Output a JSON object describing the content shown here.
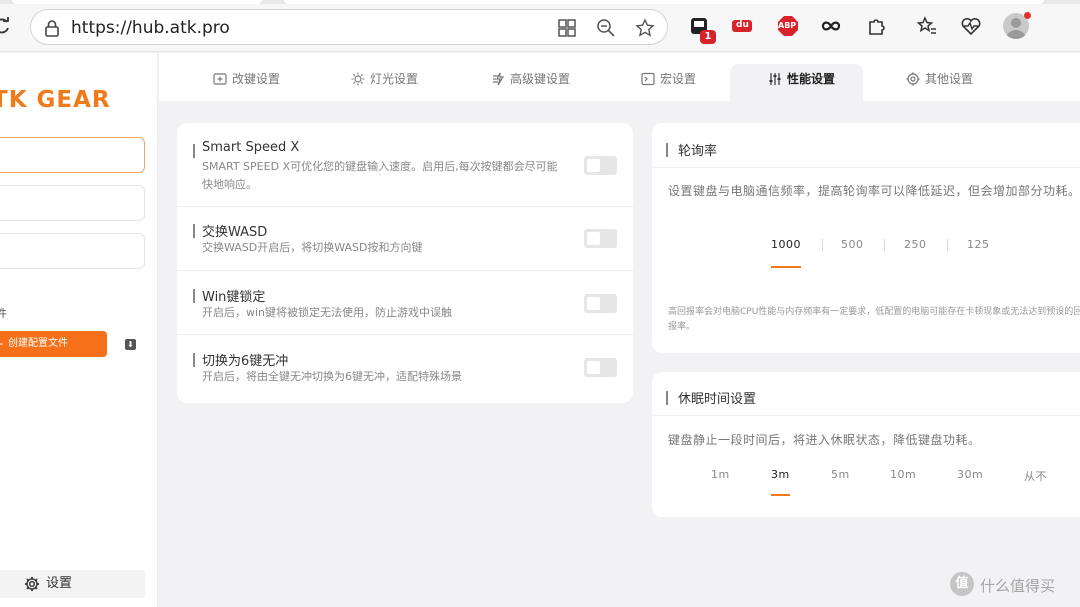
{
  "browser": {
    "url": "https://hub.atk.pro",
    "extension_badge_count": "1",
    "extension_du": "du",
    "extension_abp": "ABP"
  },
  "sidebar": {
    "logo": "TK GEAR",
    "section_label": "件",
    "create_button": "创建配置文件",
    "settings_button": "设置"
  },
  "tabs": [
    {
      "label": "改键设置",
      "icon": "keyboard-add-icon"
    },
    {
      "label": "灯光设置",
      "icon": "sun-icon"
    },
    {
      "label": "高级键设置",
      "icon": "bolt-icon"
    },
    {
      "label": "宏设置",
      "icon": "terminal-icon"
    },
    {
      "label": "性能设置",
      "icon": "sliders-icon"
    },
    {
      "label": "其他设置",
      "icon": "gear-icon"
    }
  ],
  "active_tab": "性能设置",
  "features": [
    {
      "title": "Smart Speed X",
      "desc": "SMART SPEED X可优化您的键盘输入速度。启用后,每次按键都会尽可能快地响应。",
      "enabled": false
    },
    {
      "title": "交换WASD",
      "desc": "交换WASD开启后，将切换WASD按和方向键",
      "enabled": false
    },
    {
      "title": "Win键锁定",
      "desc": "开启后，win键将被锁定无法使用，防止游戏中误触",
      "enabled": false
    },
    {
      "title": "切换为6键无冲",
      "desc": "开启后，将由全键无冲切换为6键无冲，适配特殊场景",
      "enabled": false
    }
  ],
  "polling": {
    "title": "轮询率",
    "desc": "设置键盘与电脑通信频率，提高轮询率可以降低延迟，但会增加部分功耗。",
    "options": [
      "1000",
      "500",
      "250",
      "125"
    ],
    "selected": "1000",
    "note": "高回报率会对电脑CPU性能与内存频率有一定要求，低配置的电脑可能存在卡顿现象或无法达到预设的回报率。"
  },
  "sleep": {
    "title": "休眠时间设置",
    "desc": "键盘静止一段时间后，将进入休眠状态，降低键盘功耗。",
    "options": [
      "1m",
      "3m",
      "5m",
      "10m",
      "30m",
      "从不"
    ],
    "selected": "3m"
  },
  "watermark": {
    "icon_text": "值",
    "text": "什么值得买"
  },
  "colors": {
    "accent": "#f07b1a",
    "button": "#f57018"
  }
}
